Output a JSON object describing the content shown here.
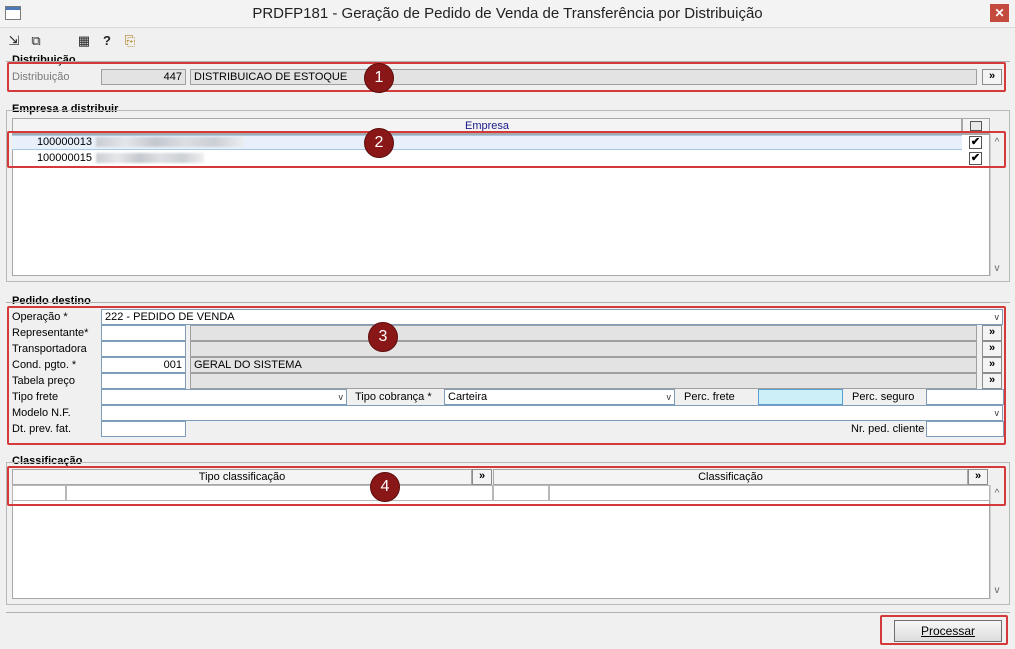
{
  "window": {
    "title": "PRDFP181 - Geração de Pedido de Venda de Transferência por Distribuição",
    "close_glyph": "✕"
  },
  "toolbar": {
    "icons": [
      {
        "name": "export-icon",
        "glyph": "⇲"
      },
      {
        "name": "copy-icon",
        "glyph": "⧉"
      },
      {
        "name": "grid-icon",
        "glyph": "▦"
      },
      {
        "name": "help-icon",
        "glyph": "?"
      },
      {
        "name": "exit-icon",
        "glyph": "⎘"
      }
    ]
  },
  "distribuicao": {
    "section": "Distribuição",
    "label": "Distribuição",
    "code": "447",
    "description": "DISTRIBUICAO DE ESTOQUE",
    "lookup": "»"
  },
  "empresa": {
    "section": "Empresa a distribuir",
    "column": "Empresa",
    "rows": [
      {
        "code": "100000013",
        "checked": "✔"
      },
      {
        "code": "100000015",
        "checked": "✔"
      }
    ]
  },
  "pedido": {
    "section": "Pedido destino",
    "operacao_label": "Operação *",
    "operacao_value": "222 - PEDIDO DE VENDA",
    "representante_label": "Representante*",
    "transportadora_label": "Transportadora",
    "cond_label": "Cond. pgto. *",
    "cond_code": "001",
    "cond_desc": "GERAL DO SISTEMA",
    "tabela_label": "Tabela preço",
    "tipo_frete_label": "Tipo frete",
    "tipo_cobranca_label": "Tipo cobrança *",
    "tipo_cobranca_value": "Carteira",
    "perc_frete_label": "Perc. frete",
    "perc_seguro_label": "Perc. seguro",
    "modelo_label": "Modelo N.F.",
    "dt_prev_label": "Dt. prev. fat.",
    "nr_ped_label": "Nr. ped. cliente",
    "lookup": "»"
  },
  "classificacao": {
    "section": "Classificação",
    "col_tipo": "Tipo classificação",
    "col_class": "Classificação",
    "lookup": "»"
  },
  "badges": [
    "1",
    "2",
    "3",
    "4"
  ],
  "actions": {
    "processar": "Processar"
  },
  "scroll": {
    "up": "^",
    "down": "v"
  },
  "dropdown_arrow": "v"
}
